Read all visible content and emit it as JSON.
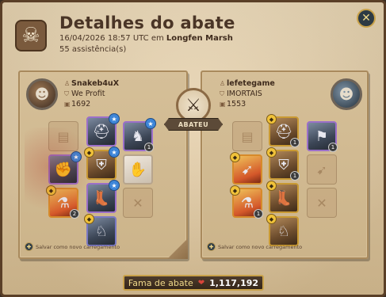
{
  "header": {
    "title": "Detalhes do abate",
    "datetime": "16/04/2026 18:57 UTC em",
    "location": "Longfen Marsh",
    "assists": "55 assistência(s)"
  },
  "center": {
    "ribbon": "ABATEU"
  },
  "killer": {
    "name": "Snakeb4uX",
    "guild": "We Profit",
    "item_power": "1692",
    "save_label": "Salvar como novo carregamento"
  },
  "victim": {
    "name": "lefetegame",
    "guild": "IMORTAIS",
    "item_power": "1553",
    "save_label": "Salvar como novo carregamento"
  },
  "footer": {
    "fame_label": "Fama de abate",
    "fame_value": "1,117,192"
  },
  "colors": {
    "parchment": "#e2caa2",
    "panel": "#ccb48a",
    "gold": "#c9a24a",
    "purple_rarity": "#7b79c4",
    "orange_rarity": "#d68a2a"
  }
}
